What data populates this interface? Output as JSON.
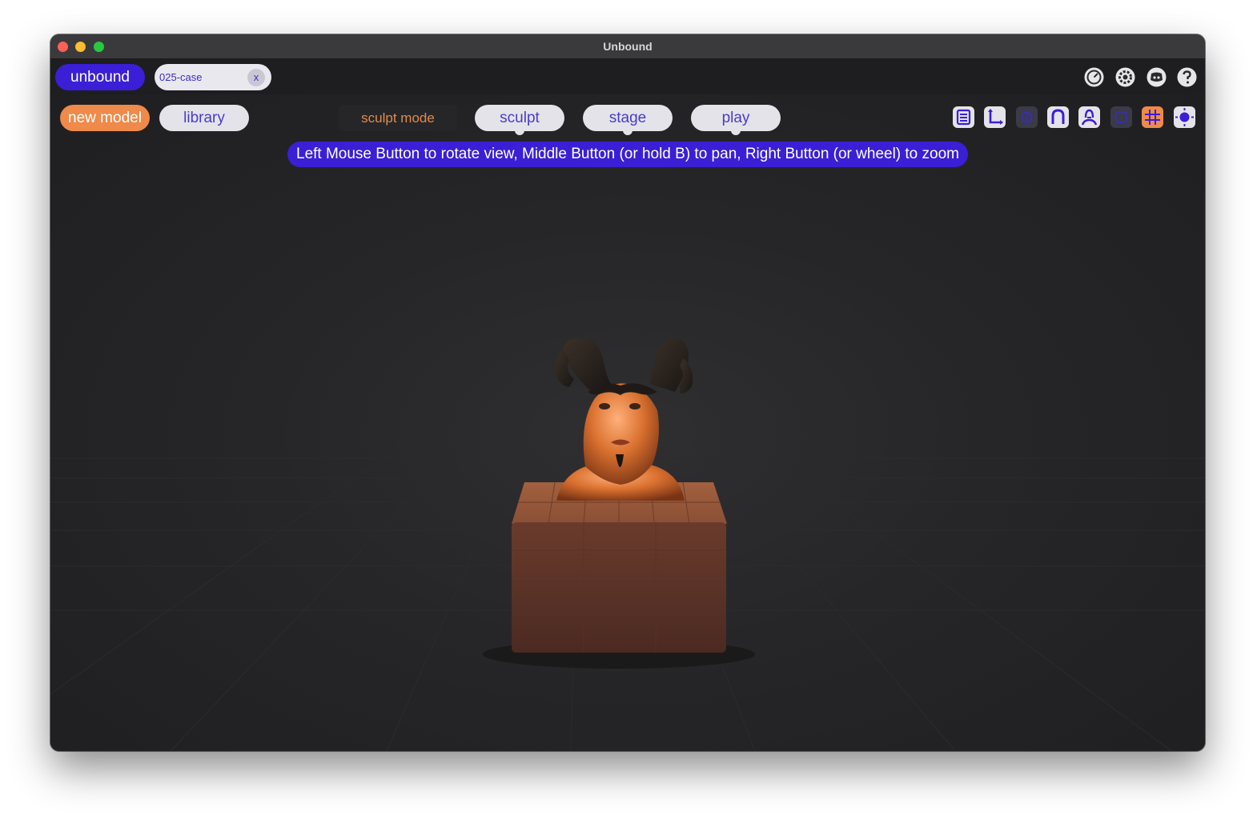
{
  "window": {
    "title": "Unbound"
  },
  "topbar": {
    "brand_label": "unbound",
    "file_tab": {
      "name": "025-case",
      "close_label": "x"
    },
    "system_icons": [
      "performance-gauge-icon",
      "settings-gear-icon",
      "discord-icon",
      "help-icon"
    ]
  },
  "toolbar": {
    "new_model_label": "new model",
    "library_label": "library",
    "mode_label": "sculpt mode",
    "mode_tabs": [
      {
        "label": "sculpt"
      },
      {
        "label": "stage"
      },
      {
        "label": "play"
      }
    ],
    "tool_icons": [
      "layers-panel-icon",
      "axes-icon",
      "symmetry-icon",
      "magnet-icon",
      "model-bust-icon",
      "frame-icon",
      "grid-icon",
      "light-icon"
    ]
  },
  "viewport": {
    "hint": "Left Mouse Button to rotate view, Middle Button (or hold B) to pan, Right Button (or wheel) to zoom",
    "model": "horned bust on block"
  },
  "colors": {
    "accent_purple": "#3b1fd6",
    "accent_orange": "#ef8a4a",
    "pill_light": "#e4e3ea",
    "background": "#232325"
  }
}
